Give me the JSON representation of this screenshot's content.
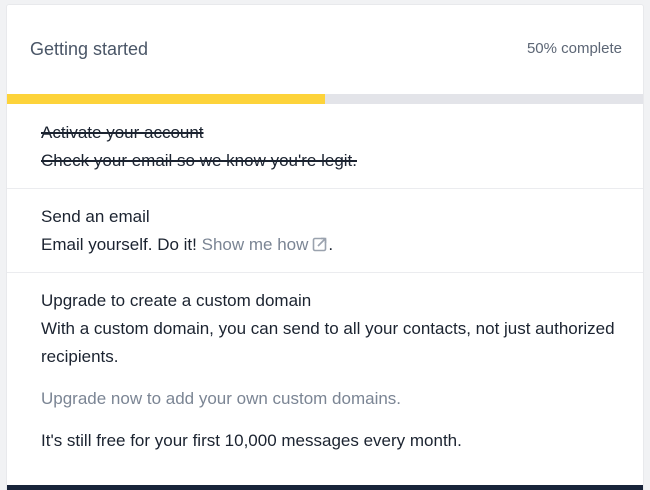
{
  "header": {
    "title": "Getting started",
    "status": "50% complete"
  },
  "progress": {
    "fraction": 0.5,
    "fill_color": "#fdd33a",
    "track_color": "#e3e4e9"
  },
  "steps": [
    {
      "title": "Activate your account",
      "description": "Check your email so we know you're legit.",
      "completed": true
    },
    {
      "title": "Send an email",
      "description_prefix": "Email yourself. Do it!",
      "link_text": "Show me how",
      "link_icon": "external-link-icon",
      "description_suffix": ".",
      "completed": false
    },
    {
      "title": "Upgrade to create a custom domain",
      "description": "With a custom domain, you can send to all your contacts, not just authorized recipients.",
      "note": "Upgrade now to add your own custom domains.",
      "footer": "It's still free for your first 10,000 messages every month.",
      "completed": false
    }
  ]
}
